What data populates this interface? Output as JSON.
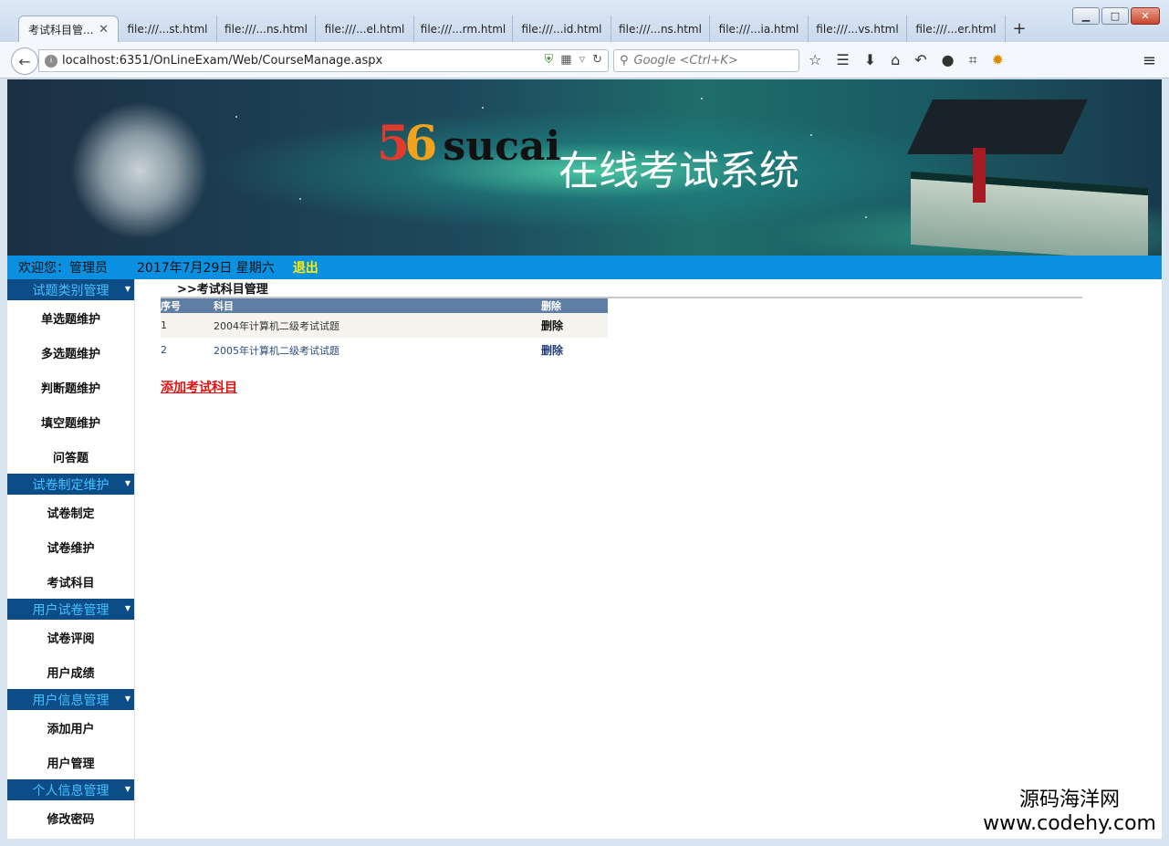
{
  "browser": {
    "tabs": [
      {
        "label": "考试科目管...",
        "active": true
      },
      {
        "label": "file:///...st.html"
      },
      {
        "label": "file:///...ns.html"
      },
      {
        "label": "file:///...el.html"
      },
      {
        "label": "file:///...rm.html"
      },
      {
        "label": "file:///...id.html"
      },
      {
        "label": "file:///...ns.html"
      },
      {
        "label": "file:///...ia.html"
      },
      {
        "label": "file:///...vs.html"
      },
      {
        "label": "file:///...er.html"
      }
    ],
    "url": "localhost:6351/OnLineExam/Web/CourseManage.aspx",
    "search_placeholder": "Google <Ctrl+K>"
  },
  "banner": {
    "logo_digit_1": "5",
    "logo_digit_2": "6",
    "logo_text": "sucai",
    "title": "在线考试系统"
  },
  "infobar": {
    "welcome": "欢迎您：管理员",
    "date": "2017年7月29日 星期六",
    "logout": "退出"
  },
  "sidebar": {
    "groups": [
      {
        "title": "试题类别管理",
        "items": [
          "单选题维护",
          "多选题维护",
          "判断题维护",
          "填空题维护",
          "问答题"
        ]
      },
      {
        "title": "试卷制定维护",
        "items": [
          "试卷制定",
          "试卷维护",
          "考试科目"
        ]
      },
      {
        "title": "用户试卷管理",
        "items": [
          "试卷评阅",
          "用户成绩"
        ]
      },
      {
        "title": "用户信息管理",
        "items": [
          "添加用户",
          "用户管理"
        ]
      },
      {
        "title": "个人信息管理",
        "items": [
          "修改密码"
        ]
      }
    ]
  },
  "content": {
    "breadcrumb": ">>考试科目管理",
    "table": {
      "headers": [
        "序号",
        "科目",
        "删除"
      ],
      "rows": [
        {
          "index": "1",
          "name": "2004年计算机二级考试试题",
          "action": "删除"
        },
        {
          "index": "2",
          "name": "2005年计算机二级考试试题",
          "action": "删除"
        }
      ]
    },
    "add_link": "添加考试科目"
  },
  "watermark": {
    "line1": "源码海洋网",
    "line2": "www.codehy.com"
  }
}
